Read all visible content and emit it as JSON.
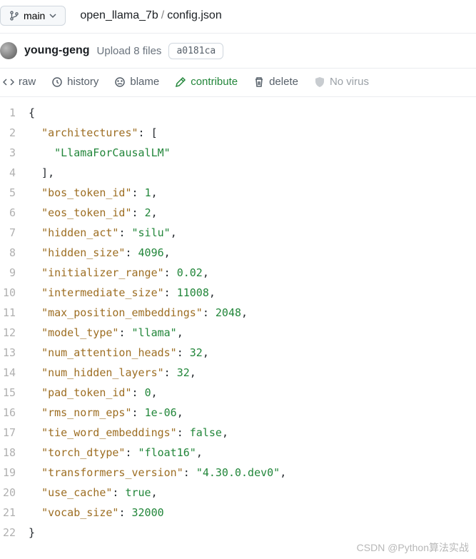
{
  "branch": {
    "label": "main"
  },
  "breadcrumb": {
    "repo": "open_llama_7b",
    "sep": "/",
    "file": "config.json"
  },
  "commit": {
    "author": "young-geng",
    "message": "Upload 8 files",
    "hash": "a0181ca"
  },
  "actions": {
    "raw": "raw",
    "history": "history",
    "blame": "blame",
    "contribute": "contribute",
    "delete": "delete",
    "novirus": "No virus"
  },
  "code": {
    "lines": [
      [
        [
          "p",
          "{"
        ]
      ],
      [
        [
          "p",
          "  "
        ],
        [
          "k",
          "\"architectures\""
        ],
        [
          "p",
          ": ["
        ]
      ],
      [
        [
          "p",
          "    "
        ],
        [
          "s",
          "\"LlamaForCausalLM\""
        ]
      ],
      [
        [
          "p",
          "  ],"
        ]
      ],
      [
        [
          "p",
          "  "
        ],
        [
          "k",
          "\"bos_token_id\""
        ],
        [
          "p",
          ": "
        ],
        [
          "n",
          "1"
        ],
        [
          "p",
          ","
        ]
      ],
      [
        [
          "p",
          "  "
        ],
        [
          "k",
          "\"eos_token_id\""
        ],
        [
          "p",
          ": "
        ],
        [
          "n",
          "2"
        ],
        [
          "p",
          ","
        ]
      ],
      [
        [
          "p",
          "  "
        ],
        [
          "k",
          "\"hidden_act\""
        ],
        [
          "p",
          ": "
        ],
        [
          "s",
          "\"silu\""
        ],
        [
          "p",
          ","
        ]
      ],
      [
        [
          "p",
          "  "
        ],
        [
          "k",
          "\"hidden_size\""
        ],
        [
          "p",
          ": "
        ],
        [
          "n",
          "4096"
        ],
        [
          "p",
          ","
        ]
      ],
      [
        [
          "p",
          "  "
        ],
        [
          "k",
          "\"initializer_range\""
        ],
        [
          "p",
          ": "
        ],
        [
          "n",
          "0.02"
        ],
        [
          "p",
          ","
        ]
      ],
      [
        [
          "p",
          "  "
        ],
        [
          "k",
          "\"intermediate_size\""
        ],
        [
          "p",
          ": "
        ],
        [
          "n",
          "11008"
        ],
        [
          "p",
          ","
        ]
      ],
      [
        [
          "p",
          "  "
        ],
        [
          "k",
          "\"max_position_embeddings\""
        ],
        [
          "p",
          ": "
        ],
        [
          "n",
          "2048"
        ],
        [
          "p",
          ","
        ]
      ],
      [
        [
          "p",
          "  "
        ],
        [
          "k",
          "\"model_type\""
        ],
        [
          "p",
          ": "
        ],
        [
          "s",
          "\"llama\""
        ],
        [
          "p",
          ","
        ]
      ],
      [
        [
          "p",
          "  "
        ],
        [
          "k",
          "\"num_attention_heads\""
        ],
        [
          "p",
          ": "
        ],
        [
          "n",
          "32"
        ],
        [
          "p",
          ","
        ]
      ],
      [
        [
          "p",
          "  "
        ],
        [
          "k",
          "\"num_hidden_layers\""
        ],
        [
          "p",
          ": "
        ],
        [
          "n",
          "32"
        ],
        [
          "p",
          ","
        ]
      ],
      [
        [
          "p",
          "  "
        ],
        [
          "k",
          "\"pad_token_id\""
        ],
        [
          "p",
          ": "
        ],
        [
          "n",
          "0"
        ],
        [
          "p",
          ","
        ]
      ],
      [
        [
          "p",
          "  "
        ],
        [
          "k",
          "\"rms_norm_eps\""
        ],
        [
          "p",
          ": "
        ],
        [
          "n",
          "1e-06"
        ],
        [
          "p",
          ","
        ]
      ],
      [
        [
          "p",
          "  "
        ],
        [
          "k",
          "\"tie_word_embeddings\""
        ],
        [
          "p",
          ": "
        ],
        [
          "b",
          "false"
        ],
        [
          "p",
          ","
        ]
      ],
      [
        [
          "p",
          "  "
        ],
        [
          "k",
          "\"torch_dtype\""
        ],
        [
          "p",
          ": "
        ],
        [
          "s",
          "\"float16\""
        ],
        [
          "p",
          ","
        ]
      ],
      [
        [
          "p",
          "  "
        ],
        [
          "k",
          "\"transformers_version\""
        ],
        [
          "p",
          ": "
        ],
        [
          "s",
          "\"4.30.0.dev0\""
        ],
        [
          "p",
          ","
        ]
      ],
      [
        [
          "p",
          "  "
        ],
        [
          "k",
          "\"use_cache\""
        ],
        [
          "p",
          ": "
        ],
        [
          "b",
          "true"
        ],
        [
          "p",
          ","
        ]
      ],
      [
        [
          "p",
          "  "
        ],
        [
          "k",
          "\"vocab_size\""
        ],
        [
          "p",
          ": "
        ],
        [
          "n",
          "32000"
        ]
      ],
      [
        [
          "p",
          "}"
        ]
      ]
    ]
  },
  "watermark": "CSDN @Python算法实战"
}
